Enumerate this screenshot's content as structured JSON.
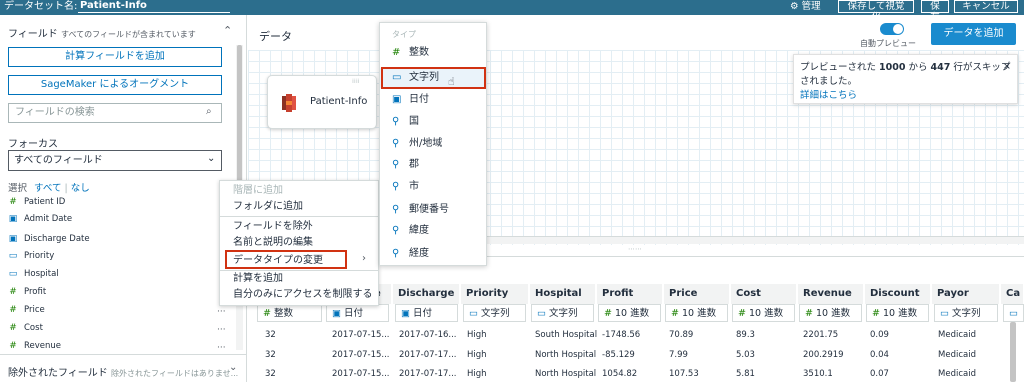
{
  "topbar": {
    "dataset_label": "データセット名:",
    "dataset_name": "Patient-Info",
    "manage": "管理",
    "save_visualize": "保存して視覚化",
    "save": "保存",
    "cancel": "キャンセル"
  },
  "left_panel": {
    "fields_title": "フィールド",
    "fields_note": "すべてのフィールドが含まれています",
    "add_calc": "計算フィールドを追加",
    "sagemaker": "SageMaker によるオーグメント",
    "search_placeholder": "フィールドの検索",
    "focus_label": "フォーカス",
    "focus_value": "すべてのフィールド",
    "select_label": "選択",
    "select_all": "すべて",
    "select_none": "なし",
    "fields": [
      {
        "name": "Patient ID",
        "icon": "hash-icon"
      },
      {
        "name": "Admit Date",
        "icon": "calendar-icon"
      },
      {
        "name": "Discharge Date",
        "icon": "calendar-icon"
      },
      {
        "name": "Priority",
        "icon": "text-icon"
      },
      {
        "name": "Hospital",
        "icon": "text-icon"
      },
      {
        "name": "Profit",
        "icon": "hash-icon"
      },
      {
        "name": "Price",
        "icon": "hash-icon"
      },
      {
        "name": "Cost",
        "icon": "hash-icon"
      },
      {
        "name": "Revenue",
        "icon": "hash-icon"
      }
    ],
    "excluded_title": "除外されたフィールド",
    "excluded_note": "除外されたフィールドはありませ..."
  },
  "main": {
    "data_title": "データ",
    "auto_preview": "自動プレビュー",
    "add_data": "データを追加",
    "node_label": "Patient-Info"
  },
  "notice": {
    "text_pre": "プレビューされた ",
    "count1": "1000",
    "text_mid": " から ",
    "count2": "447",
    "text_post": " 行がスキップされました。",
    "link": "詳細はこちら",
    "close": "×"
  },
  "context_menu": {
    "items": [
      "階層に追加",
      "フォルダに追加",
      "フィールドを除外",
      "名前と説明の編集",
      "データタイプの変更",
      "計算を追加",
      "自分のみにアクセスを制限する"
    ]
  },
  "type_menu": {
    "header": "タイプ",
    "items": [
      {
        "label": "整数",
        "icon": "hash-icon"
      },
      {
        "label": "文字列",
        "icon": "text-icon"
      },
      {
        "label": "日付",
        "icon": "calendar-icon"
      },
      {
        "label": "国",
        "icon": "location-icon"
      },
      {
        "label": "州/地域",
        "icon": "location-icon"
      },
      {
        "label": "郡",
        "icon": "location-icon"
      },
      {
        "label": "市",
        "icon": "location-icon"
      },
      {
        "label": "郵便番号",
        "icon": "location-icon"
      },
      {
        "label": "緯度",
        "icon": "location-icon"
      },
      {
        "label": "経度",
        "icon": "location-icon"
      }
    ]
  },
  "table": {
    "columns": [
      {
        "name": "",
        "type": "整数",
        "icon": "hash-icon"
      },
      {
        "name": "e",
        "type": "日付",
        "icon": "calendar-icon"
      },
      {
        "name": "Discharge ...",
        "type": "日付",
        "icon": "calendar-icon"
      },
      {
        "name": "Priority",
        "type": "文字列",
        "icon": "text-icon"
      },
      {
        "name": "Hospital",
        "type": "文字列",
        "icon": "text-icon"
      },
      {
        "name": "Profit",
        "type": "10 進数",
        "icon": "hash-icon"
      },
      {
        "name": "Price",
        "type": "10 進数",
        "icon": "hash-icon"
      },
      {
        "name": "Cost",
        "type": "10 進数",
        "icon": "hash-icon"
      },
      {
        "name": "Revenue",
        "type": "10 進数",
        "icon": "hash-icon"
      },
      {
        "name": "Discount",
        "type": "10 進数",
        "icon": "hash-icon"
      },
      {
        "name": "Payor Seg...",
        "type": "文字列",
        "icon": "text-icon"
      },
      {
        "name": "Ca",
        "type": "",
        "icon": "text-icon"
      }
    ],
    "rows": [
      [
        "32",
        "2017-07-15...",
        "2017-07-16...",
        "High",
        "South Hospital",
        "-1748.56",
        "70.89",
        "89.3",
        "2201.75",
        "0.09",
        "Medicaid"
      ],
      [
        "32",
        "2017-07-15...",
        "2017-07-17...",
        "High",
        "North Hospital",
        "-85.129",
        "7.99",
        "5.03",
        "200.2919",
        "0.04",
        "Medicaid"
      ],
      [
        "32",
        "2017-07-15...",
        "2017-07-17...",
        "High",
        "North Hospital",
        "1054.82",
        "107.53",
        "5.81",
        "3510.1",
        "0.07",
        "Medicaid"
      ]
    ]
  }
}
